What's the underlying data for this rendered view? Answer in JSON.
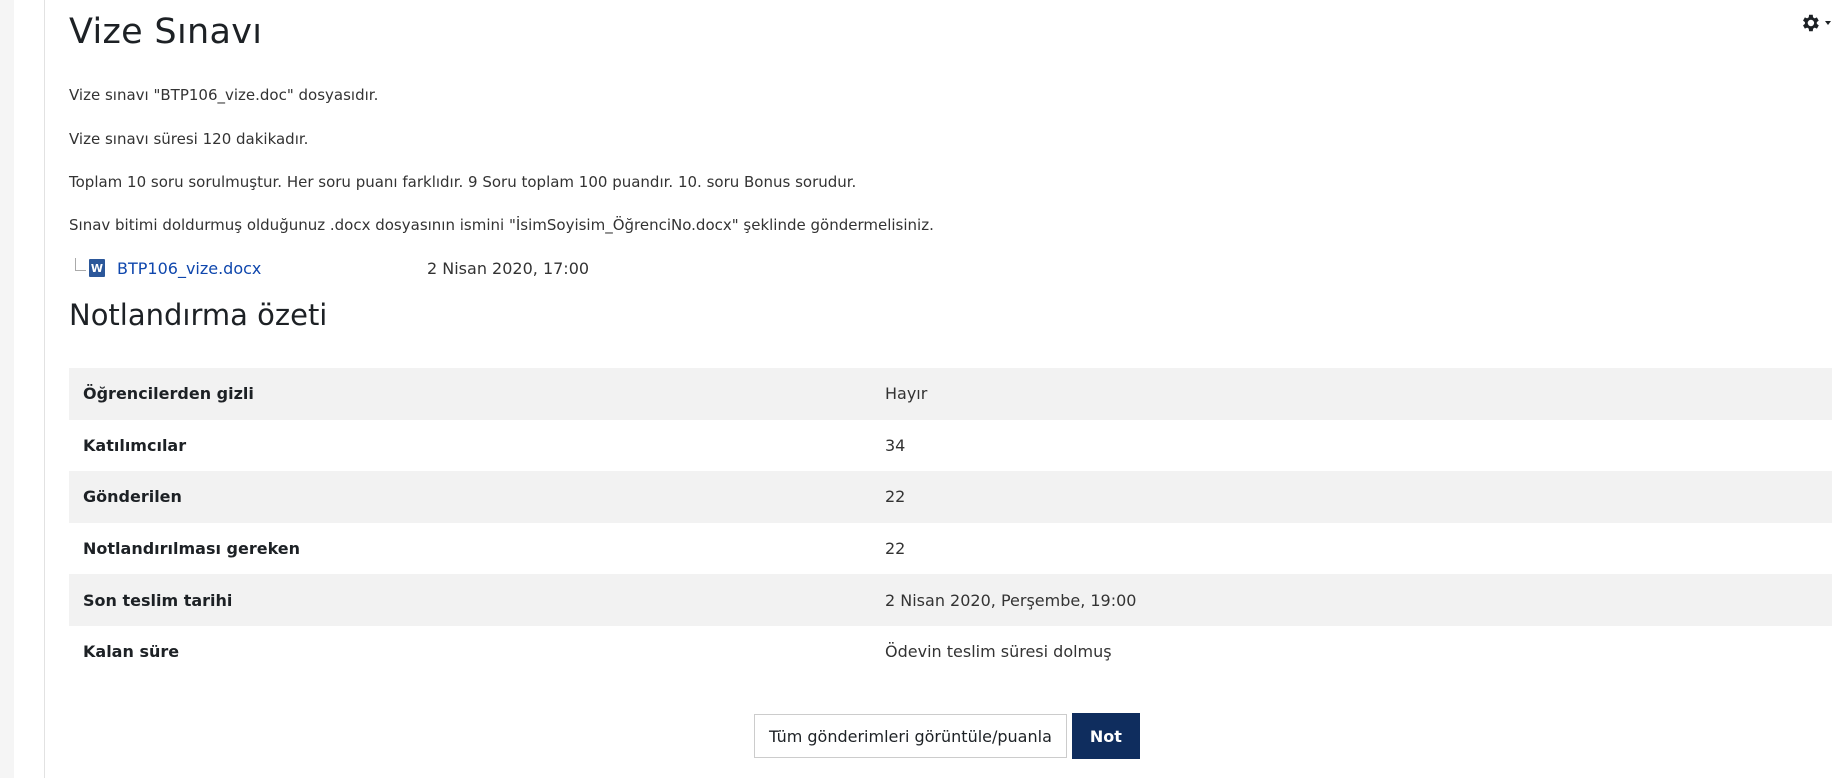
{
  "page": {
    "title": "Vize Sınavı"
  },
  "settings_menu": {
    "icon": "gear-icon"
  },
  "description": {
    "lines": [
      "Vize sınavı \"BTP106_vize.doc\" dosyasıdır.",
      "Vize sınavı süresi 120 dakikadır.",
      "Toplam 10 soru sorulmuştur. Her soru puanı farklıdır. 9 Soru toplam 100 puandır. 10. soru Bonus sorudur.",
      "Sınav bitimi doldurmuş olduğunuz .docx dosyasının ismini \"İsimSoyisim_ÖğrenciNo.docx\" şeklinde göndermelisiniz."
    ]
  },
  "attachment": {
    "icon": "word-file-icon",
    "icon_letter": "W",
    "filename": "BTP106_vize.docx",
    "date": "2 Nisan 2020, 17:00"
  },
  "grading_summary": {
    "title": "Notlandırma özeti",
    "rows": [
      {
        "label": "Öğrencilerden gizli",
        "value": "Hayır"
      },
      {
        "label": "Katılımcılar",
        "value": "34"
      },
      {
        "label": "Gönderilen",
        "value": "22"
      },
      {
        "label": "Notlandırılması gereken",
        "value": "22"
      },
      {
        "label": "Son teslim tarihi",
        "value": "2 Nisan 2020, Perşembe, 19:00"
      },
      {
        "label": "Kalan süre",
        "value": "Ödevin teslim süresi dolmuş"
      }
    ]
  },
  "actions": {
    "view_all_label": "Tüm gönderimleri görüntüle/puanla",
    "grade_label": "Not"
  },
  "colors": {
    "primary_button": "#0f2d5e",
    "link": "#0f47ad",
    "row_stripe": "#f2f2f2"
  }
}
